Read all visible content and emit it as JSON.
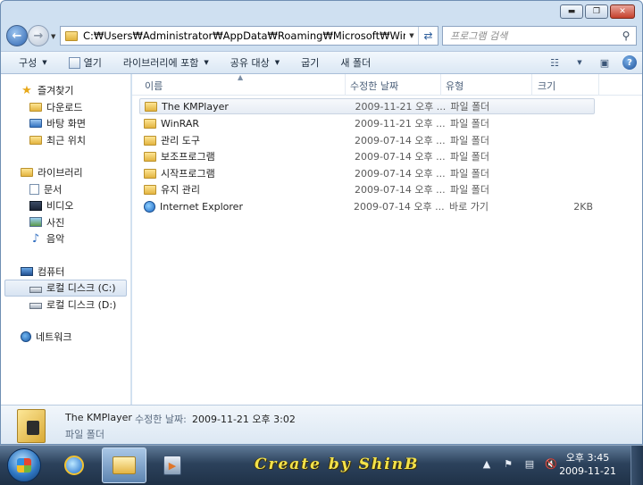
{
  "window": {
    "caption": {
      "minimize": "▬",
      "maximize": "❐",
      "close": "✕"
    }
  },
  "nav": {
    "back_glyph": "←",
    "forward_glyph": "→",
    "address_path": "C:₩Users₩Administrator₩AppData₩Roaming₩Microsoft₩Windows₩Start M",
    "search_placeholder": "프로그램 검색"
  },
  "commandbar": {
    "items": [
      "구성",
      "열기",
      "라이브러리에 포함",
      "공유 대상",
      "굽기",
      "새 폴더"
    ]
  },
  "sidebar": {
    "favorites": {
      "label": "즐겨찾기",
      "items": [
        "다운로드",
        "바탕 화면",
        "최근 위치"
      ]
    },
    "libraries": {
      "label": "라이브러리",
      "items": [
        "문서",
        "비디오",
        "사진",
        "음악"
      ]
    },
    "computer": {
      "label": "컴퓨터",
      "items": [
        "로컬 디스크 (C:)",
        "로컬 디스크 (D:)"
      ]
    },
    "network": {
      "label": "네트워크"
    }
  },
  "filelist": {
    "columns": {
      "name": "이름",
      "date": "수정한 날짜",
      "type": "유형",
      "size": "크기"
    },
    "rows": [
      {
        "name": "The KMPlayer",
        "date": "2009-11-21 오후 ...",
        "type": "파일 폴더",
        "size": "",
        "icon": "folder-icon"
      },
      {
        "name": "WinRAR",
        "date": "2009-11-21 오후 ...",
        "type": "파일 폴더",
        "size": "",
        "icon": "folder-icon"
      },
      {
        "name": "관리 도구",
        "date": "2009-07-14 오후 ...",
        "type": "파일 폴더",
        "size": "",
        "icon": "folder-icon"
      },
      {
        "name": "보조프로그램",
        "date": "2009-07-14 오후 ...",
        "type": "파일 폴더",
        "size": "",
        "icon": "folder-icon"
      },
      {
        "name": "시작프로그램",
        "date": "2009-07-14 오후 ...",
        "type": "파일 폴더",
        "size": "",
        "icon": "folder-icon"
      },
      {
        "name": "유지 관리",
        "date": "2009-07-14 오후 ...",
        "type": "파일 폴더",
        "size": "",
        "icon": "folder-icon"
      },
      {
        "name": "Internet Explorer",
        "date": "2009-07-14 오후 ...",
        "type": "바로 가기",
        "size": "2KB",
        "icon": "internet-explorer-shortcut-icon"
      }
    ]
  },
  "details": {
    "name": "The KMPlayer",
    "date_label": "수정한 날짜:",
    "date_value": "2009-11-21 오후 3:02",
    "type": "파일 폴더"
  },
  "taskbar": {
    "watermark": "Create by ShinB",
    "clock_time": "오후 3:45",
    "clock_date": "2009-11-21"
  },
  "colors": {
    "window_frame": "#cfe0f1",
    "selection": "#e6ecf4",
    "taskbar": "#2c425c",
    "watermark": "#f3e24a"
  }
}
